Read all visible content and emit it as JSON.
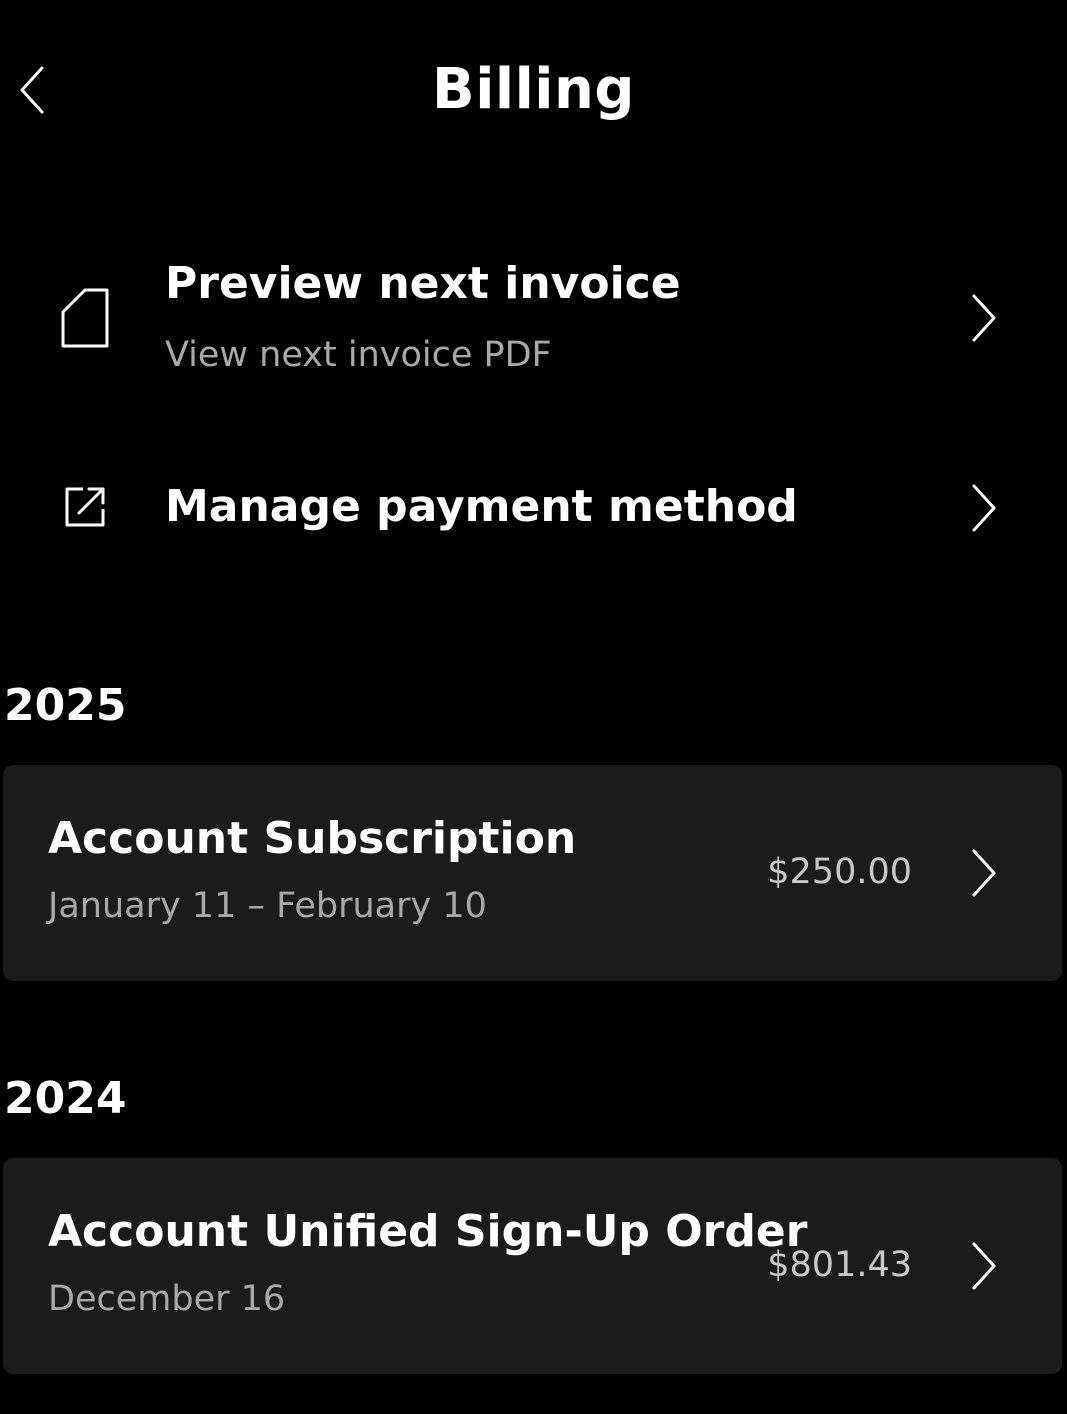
{
  "header": {
    "title": "Billing",
    "back_icon": "chevron-left-icon"
  },
  "actions": [
    {
      "icon": "document-icon",
      "title": "Preview next invoice",
      "subtitle": "View next invoice PDF"
    },
    {
      "icon": "external-link-icon",
      "title": "Manage payment method"
    }
  ],
  "years": [
    {
      "year": "2025",
      "items": [
        {
          "title": "Account Subscription",
          "date": "January 11 – February 10",
          "amount": "$250.00"
        }
      ]
    },
    {
      "year": "2024",
      "items": [
        {
          "title": "Account Unified Sign-Up Order",
          "date": "December 16",
          "amount": "$801.43"
        }
      ]
    }
  ],
  "colors": {
    "background": "#000000",
    "card": "#1b1b1b",
    "primary_text": "#ffffff",
    "secondary_text": "#a8a8a8"
  }
}
